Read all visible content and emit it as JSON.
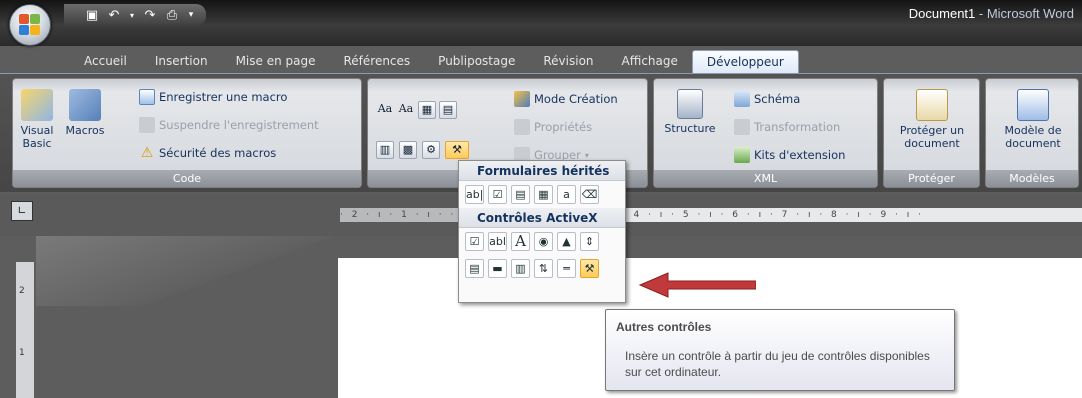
{
  "window": {
    "doc_name": "Document1",
    "separator": " - ",
    "app_name": "Microsoft Word"
  },
  "tabs": [
    {
      "label": "Accueil"
    },
    {
      "label": "Insertion"
    },
    {
      "label": "Mise en page"
    },
    {
      "label": "Références"
    },
    {
      "label": "Publipostage"
    },
    {
      "label": "Révision"
    },
    {
      "label": "Affichage"
    },
    {
      "label": "Développeur",
      "active": true
    }
  ],
  "groups": {
    "code": {
      "label": "Code",
      "visual_basic": "Visual Basic",
      "macros": "Macros",
      "record_macro": "Enregistrer une macro",
      "pause_recording": "Suspendre l'enregistrement",
      "macro_security": "Sécurité des macros"
    },
    "controls": {
      "mode_creation": "Mode Création",
      "proprietes": "Propriétés",
      "grouper": "Grouper"
    },
    "xml": {
      "label": "XML",
      "structure": "Structure",
      "schema": "Schéma",
      "transformation": "Transformation",
      "kits": "Kits d'extension"
    },
    "protect": {
      "label": "Protéger",
      "button": "Protéger un document"
    },
    "templates": {
      "label": "Modèles",
      "button": "Modèle de document"
    }
  },
  "dropdown": {
    "legacy_heading": "Formulaires hérités",
    "activex_heading": "Contrôles ActiveX"
  },
  "ruler": {
    "ticks": "· 2 · ı · 1 · ı ·   · ı · 1 · ı · 2 · ı · 3 · ı · 4 · ı · 5 · ı · 6 · ı · 7 · ı · 8 · ı · 9 · ı ·",
    "vticks": [
      "2",
      "1"
    ]
  },
  "tooltip": {
    "title": "Autres contrôles",
    "body": "Insère un contrôle à partir du jeu de contrôles disponibles sur cet ordinateur."
  },
  "colors": {
    "arrow": "#c0393b",
    "highlight": "#ffc95a"
  }
}
